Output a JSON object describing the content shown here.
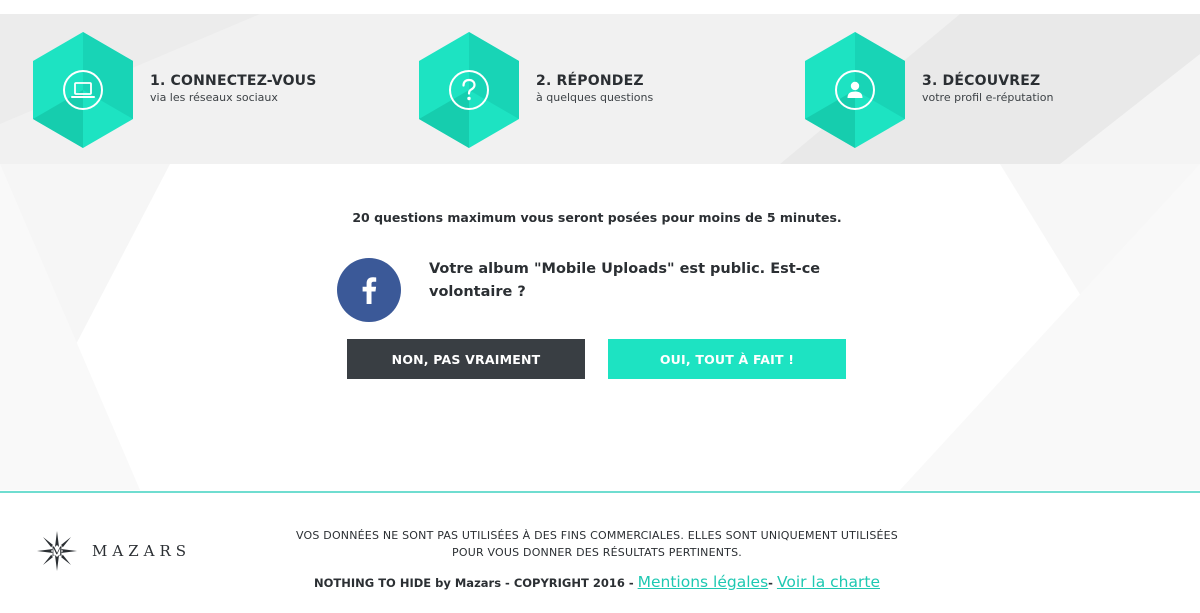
{
  "steps": [
    {
      "title": "1. CONNECTEZ-VOUS",
      "subtitle": "via les réseaux sociaux",
      "icon": "laptop-icon"
    },
    {
      "title": "2. RÉPONDEZ",
      "subtitle": "à quelques questions",
      "icon": "question-mark-icon"
    },
    {
      "title": "3. DÉCOUVREZ",
      "subtitle": "votre profil e-réputation",
      "icon": "user-profile-icon"
    }
  ],
  "quiz": {
    "intro": "20 questions maximum vous seront posées pour moins de 5 minutes.",
    "question_line1": "Votre album \"Mobile Uploads\" est public. Est-ce",
    "question_line2": "volontaire ?",
    "source_icon": "facebook-icon",
    "no_label": "NON, PAS VRAIMENT",
    "yes_label": "OUI, TOUT À FAIT !"
  },
  "footer": {
    "brand": "MAZARS",
    "brand_letter": "M",
    "disclaimer_line1": "VOS DONNÉES NE SONT PAS UTILISÉES À DES FINS COMMERCIALES. ELLES SONT UNIQUEMENT UTILISÉES",
    "disclaimer_line2": "POUR VOUS DONNER DES RÉSULTATS PERTINENTS.",
    "copyright": "NOTHING TO HIDE by Mazars - COPYRIGHT 2016 - ",
    "legal_link": "Mentions légales",
    "separator": "- ",
    "charter_link": "Voir la charte"
  },
  "colors": {
    "accent": "#1de3c2",
    "accent_dark": "#14c9a9",
    "dark_button": "#393e43",
    "facebook": "#3b5998",
    "footer_border": "#6fddd0",
    "link": "#1fc8b2"
  }
}
